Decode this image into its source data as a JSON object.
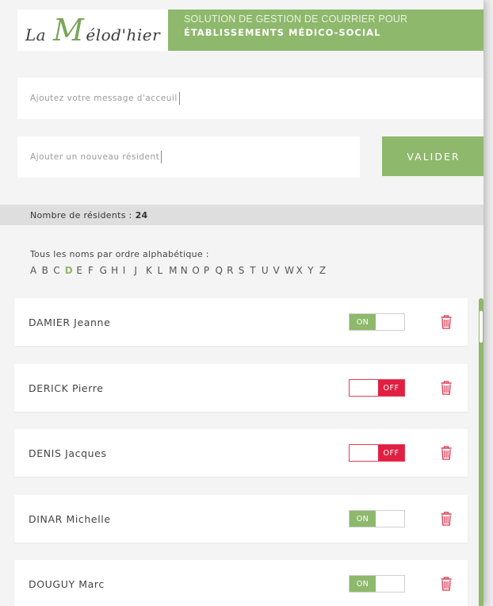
{
  "header": {
    "logo": {
      "part1": "La",
      "big_letter": "M",
      "part2": "élod'hier"
    },
    "banner_line1": "SOLUTION DE GESTION DE COURRIER POUR",
    "banner_line2": "ÉTABLISSEMENTS MÉDICO-SOCIAL"
  },
  "welcome_input": {
    "placeholder": "Ajoutez votre message d'acceuil"
  },
  "resident_input": {
    "placeholder": "Ajouter un nouveau résident"
  },
  "valider_label": "VALIDER",
  "count": {
    "label": "Nombre de résidents :",
    "value": "24"
  },
  "alphabet": {
    "label": "Tous les noms par ordre alphabétique :",
    "letters": [
      "A",
      "B",
      "C",
      "D",
      "E",
      "F",
      "G",
      "H",
      "I",
      "J",
      "K",
      "L",
      "M",
      "N",
      "O",
      "P",
      "Q",
      "R",
      "S",
      "T",
      "U",
      "V",
      "W",
      "X",
      "Y",
      "Z"
    ],
    "active": "D"
  },
  "residents": [
    {
      "name": "DAMIER Jeanne",
      "status": "ON"
    },
    {
      "name": "DERICK Pierre",
      "status": "OFF"
    },
    {
      "name": "DENIS Jacques",
      "status": "OFF"
    },
    {
      "name": "DINAR Michelle",
      "status": "ON"
    },
    {
      "name": "DOUGUY Marc",
      "status": "ON"
    }
  ],
  "colors": {
    "accent": "#8eb86c",
    "off": "#e02042",
    "trash": "#d9304a"
  },
  "icons": {
    "delete": "trash-icon"
  }
}
